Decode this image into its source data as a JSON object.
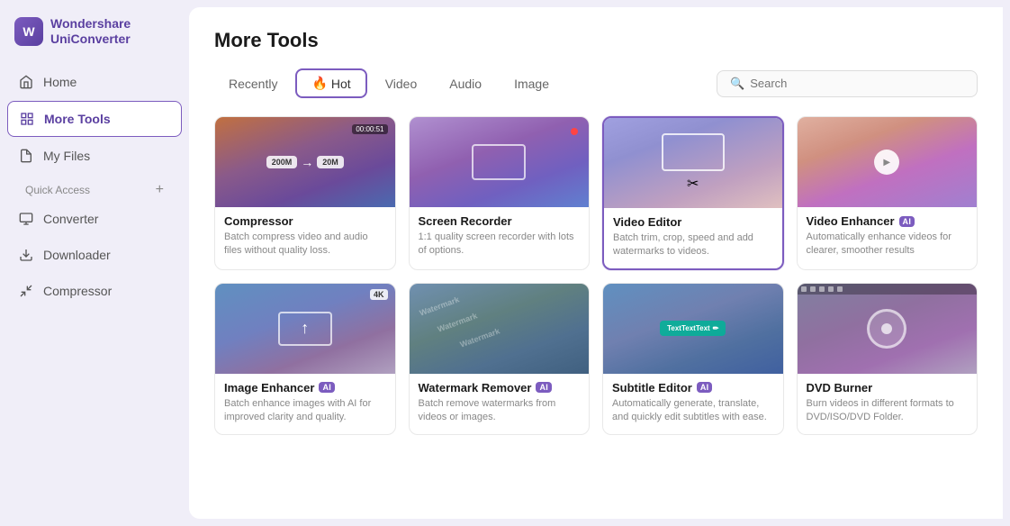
{
  "app": {
    "name": "Wondershare",
    "product": "UniConverter"
  },
  "sidebar": {
    "nav_items": [
      {
        "id": "home",
        "label": "Home",
        "icon": "home"
      },
      {
        "id": "more-tools",
        "label": "More Tools",
        "icon": "grid",
        "active": true
      },
      {
        "id": "my-files",
        "label": "My Files",
        "icon": "file"
      }
    ],
    "quick_access_label": "Quick Access",
    "quick_access_items": [
      {
        "id": "converter",
        "label": "Converter",
        "icon": "convert"
      },
      {
        "id": "downloader",
        "label": "Downloader",
        "icon": "download"
      },
      {
        "id": "compressor",
        "label": "Compressor",
        "icon": "compress"
      }
    ]
  },
  "page": {
    "title": "More Tools",
    "tabs": [
      {
        "id": "recently",
        "label": "Recently"
      },
      {
        "id": "hot",
        "label": "Hot",
        "active": true,
        "icon": "🔥"
      },
      {
        "id": "video",
        "label": "Video"
      },
      {
        "id": "audio",
        "label": "Audio"
      },
      {
        "id": "image",
        "label": "Image"
      }
    ],
    "search": {
      "placeholder": "Search"
    }
  },
  "tools": [
    {
      "id": "compressor",
      "name": "Compressor",
      "desc": "Batch compress video and audio files without quality loss.",
      "ai": false,
      "selected": false,
      "thumb": "compressor"
    },
    {
      "id": "screen-recorder",
      "name": "Screen Recorder",
      "desc": "1:1 quality screen recorder with lots of options.",
      "ai": false,
      "selected": false,
      "thumb": "screen-recorder"
    },
    {
      "id": "video-editor",
      "name": "Video Editor",
      "desc": "Batch trim, crop, speed and add watermarks to videos.",
      "ai": false,
      "selected": true,
      "thumb": "video-editor"
    },
    {
      "id": "video-enhancer",
      "name": "Video Enhancer",
      "desc": "Automatically enhance videos for clearer, smoother results",
      "ai": true,
      "selected": false,
      "thumb": "video-enhancer"
    },
    {
      "id": "image-enhancer",
      "name": "Image Enhancer",
      "desc": "Batch enhance images with AI for improved clarity and quality.",
      "ai": true,
      "selected": false,
      "thumb": "image-enhancer"
    },
    {
      "id": "watermark-remover",
      "name": "Watermark Remover",
      "desc": "Batch remove watermarks from videos or images.",
      "ai": true,
      "selected": false,
      "thumb": "watermark"
    },
    {
      "id": "subtitle-editor",
      "name": "Subtitle Editor",
      "desc": "Automatically generate, translate, and quickly edit subtitles with ease.",
      "ai": true,
      "selected": false,
      "thumb": "subtitle"
    },
    {
      "id": "dvd-burner",
      "name": "DVD Burner",
      "desc": "Burn videos in different formats to DVD/ISO/DVD Folder.",
      "ai": false,
      "selected": false,
      "thumb": "dvd"
    }
  ]
}
